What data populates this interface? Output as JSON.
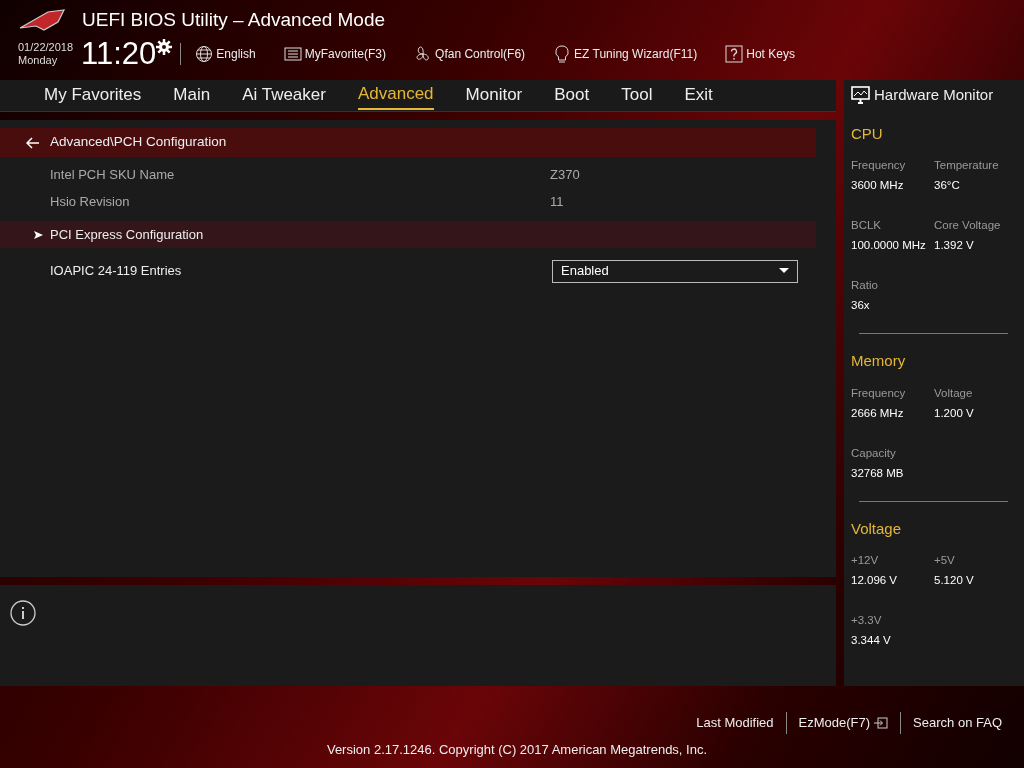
{
  "header": {
    "title": "UEFI BIOS Utility – Advanced Mode",
    "date": "01/22/2018",
    "day": "Monday",
    "time": "11:20",
    "tools": [
      {
        "kind": "language",
        "label": "English"
      },
      {
        "kind": "favorite",
        "label": "MyFavorite(F3)"
      },
      {
        "kind": "fan",
        "label": "Qfan Control(F6)"
      },
      {
        "kind": "wizard",
        "label": "EZ Tuning Wizard(F11)"
      },
      {
        "kind": "hotkeys",
        "label": "Hot Keys"
      }
    ]
  },
  "tabs": [
    {
      "label": "My Favorites",
      "selected": false
    },
    {
      "label": "Main",
      "selected": false
    },
    {
      "label": "Ai Tweaker",
      "selected": false
    },
    {
      "label": "Advanced",
      "selected": true
    },
    {
      "label": "Monitor",
      "selected": false
    },
    {
      "label": "Boot",
      "selected": false
    },
    {
      "label": "Tool",
      "selected": false
    },
    {
      "label": "Exit",
      "selected": false
    }
  ],
  "breadcrumb": "Advanced\\PCH Configuration",
  "items": [
    {
      "kind": "info",
      "label": "Intel PCH SKU Name",
      "value": "Z370",
      "selected": false
    },
    {
      "kind": "info",
      "label": "Hsio Revision",
      "value": "11",
      "selected": false
    },
    {
      "kind": "submenu",
      "label": "PCI Express Configuration",
      "selected": true
    },
    {
      "kind": "dropdown",
      "label": "IOAPIC 24-119 Entries",
      "value": "Enabled",
      "selected": false
    }
  ],
  "hardware_monitor": {
    "title": "Hardware Monitor",
    "sections": [
      {
        "title": "CPU",
        "readings": [
          {
            "label": "Frequency",
            "value": "3600 MHz"
          },
          {
            "label": "Temperature",
            "value": "36°C"
          },
          {
            "label": "BCLK",
            "value": "100.0000 MHz"
          },
          {
            "label": "Core Voltage",
            "value": "1.392 V"
          },
          {
            "label": "Ratio",
            "value": "36x"
          }
        ]
      },
      {
        "title": "Memory",
        "readings": [
          {
            "label": "Frequency",
            "value": "2666 MHz"
          },
          {
            "label": "Voltage",
            "value": "1.200 V"
          },
          {
            "label": "Capacity",
            "value": "32768 MB"
          }
        ]
      },
      {
        "title": "Voltage",
        "readings": [
          {
            "label": "+12V",
            "value": "12.096 V"
          },
          {
            "label": "+5V",
            "value": "5.120 V"
          },
          {
            "label": "+3.3V",
            "value": "3.344 V"
          }
        ]
      }
    ]
  },
  "footer": {
    "links": [
      "Last Modified",
      "EzMode(F7)",
      "Search on FAQ"
    ],
    "version": "Version 2.17.1246. Copyright (C) 2017 American Megatrends, Inc."
  }
}
